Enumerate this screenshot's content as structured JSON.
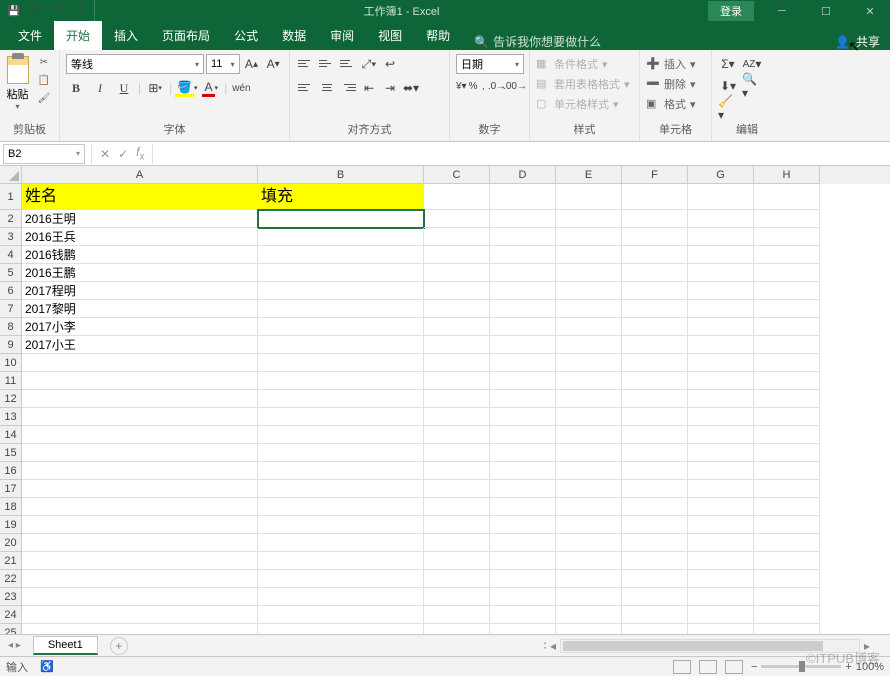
{
  "title_bar": {
    "title": "工作簿1 - Excel",
    "login": "登录"
  },
  "tabs": [
    "文件",
    "开始",
    "插入",
    "页面布局",
    "公式",
    "数据",
    "审阅",
    "视图",
    "帮助"
  ],
  "tell_me": "告诉我你想要做什么",
  "share": "共享",
  "ribbon": {
    "clipboard": {
      "paste": "粘贴",
      "label": "剪贴板"
    },
    "font": {
      "name": "等线",
      "size": "11",
      "label": "字体",
      "b": "B",
      "i": "I",
      "u": "U"
    },
    "align": {
      "label": "对齐方式"
    },
    "number": {
      "format": "日期",
      "label": "数字"
    },
    "styles": {
      "cond": "条件格式",
      "table": "套用表格格式",
      "cell": "单元格样式",
      "label": "样式"
    },
    "cells": {
      "insert": "插入",
      "delete": "删除",
      "format": "格式",
      "label": "单元格"
    },
    "editing": {
      "label": "编辑"
    }
  },
  "name_box": "B2",
  "columns": [
    "A",
    "B",
    "C",
    "D",
    "E",
    "F",
    "G",
    "H"
  ],
  "headers": {
    "a": "姓名",
    "b": "填充"
  },
  "data_rows": [
    "2016王明",
    "2016王兵",
    "2016钱鹏",
    "2016王鹏",
    "2017程明",
    "2017黎明",
    "2017小李",
    "2017小王"
  ],
  "sheet_tab": "Sheet1",
  "status": {
    "mode": "输入",
    "zoom": "100%"
  },
  "watermark": "©ITPUB博客"
}
